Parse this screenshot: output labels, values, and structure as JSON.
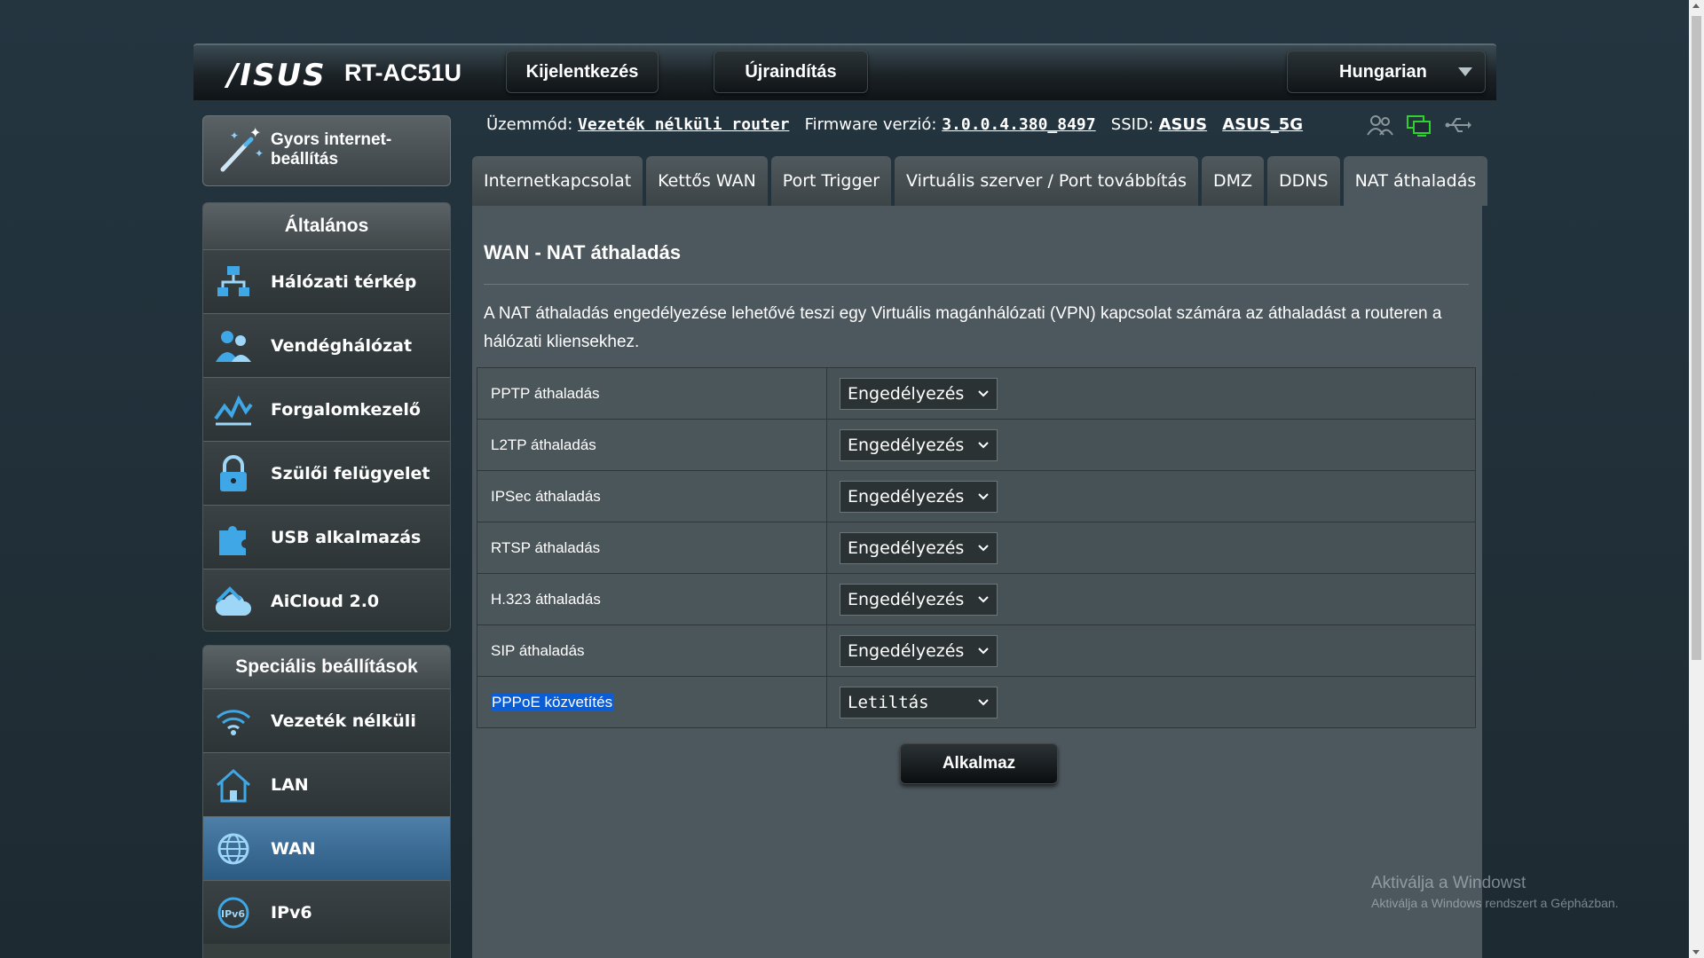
{
  "header": {
    "logo": "/ISUS",
    "model": "RT-AC51U",
    "logout": "Kijelentkezés",
    "reboot": "Újraindítás",
    "language": "Hungarian"
  },
  "quick_setup": {
    "label": "Gyors internet-beállítás"
  },
  "sidebar": {
    "general_title": "Általános",
    "general_items": [
      {
        "label": "Hálózati térkép",
        "icon": "network-map-icon"
      },
      {
        "label": "Vendéghálózat",
        "icon": "guest-network-icon"
      },
      {
        "label": "Forgalomkezelő",
        "icon": "traffic-manager-icon"
      },
      {
        "label": "Szülői felügyelet",
        "icon": "lock-icon"
      },
      {
        "label": "USB alkalmazás",
        "icon": "puzzle-icon"
      },
      {
        "label": "AiCloud 2.0",
        "icon": "cloud-icon"
      }
    ],
    "advanced_title": "Speciális beállítások",
    "advanced_items": [
      {
        "label": "Vezeték nélküli",
        "icon": "wifi-icon"
      },
      {
        "label": "LAN",
        "icon": "home-icon"
      },
      {
        "label": "WAN",
        "icon": "globe-icon",
        "active": true
      },
      {
        "label": "IPv6",
        "icon": "ipv6-icon"
      }
    ]
  },
  "status": {
    "mode_label": "Üzemmód:",
    "mode_value": "Vezeték nélküli router",
    "firmware_label": "Firmware verzió:",
    "firmware_value": "3.0.0.4.380_8497",
    "ssid_label": "SSID:",
    "ssid1": "ASUS",
    "ssid2": "ASUS_5G"
  },
  "tabs": [
    "Internetkapcsolat",
    "Kettős WAN",
    "Port Trigger",
    "Virtuális szerver / Port továbbítás",
    "DMZ",
    "DDNS",
    "NAT áthaladás"
  ],
  "page": {
    "title": "WAN - NAT áthaladás",
    "description": "A NAT áthaladás engedélyezése lehetővé teszi egy Virtuális magánhálózati (VPN) kapcsolat számára az áthaladást a routeren a hálózati kliensekhez.",
    "apply": "Alkalmaz"
  },
  "options": [
    {
      "label": "PPTP áthaladás",
      "value": "Engedélyezés"
    },
    {
      "label": "L2TP áthaladás",
      "value": "Engedélyezés"
    },
    {
      "label": "IPSec áthaladás",
      "value": "Engedélyezés"
    },
    {
      "label": "RTSP áthaladás",
      "value": "Engedélyezés"
    },
    {
      "label": "H.323 áthaladás",
      "value": "Engedélyezés"
    },
    {
      "label": "SIP áthaladás",
      "value": "Engedélyezés"
    },
    {
      "label": "PPPoE közvetítés",
      "value": "Letiltás"
    }
  ],
  "watermark": {
    "line1": "Aktiválja a Windowst",
    "line2": "Aktiválja a Windows rendszert a Gépházban."
  },
  "colors": {
    "accent_active": "#3a6f99",
    "selection": "#0b5dd6"
  }
}
